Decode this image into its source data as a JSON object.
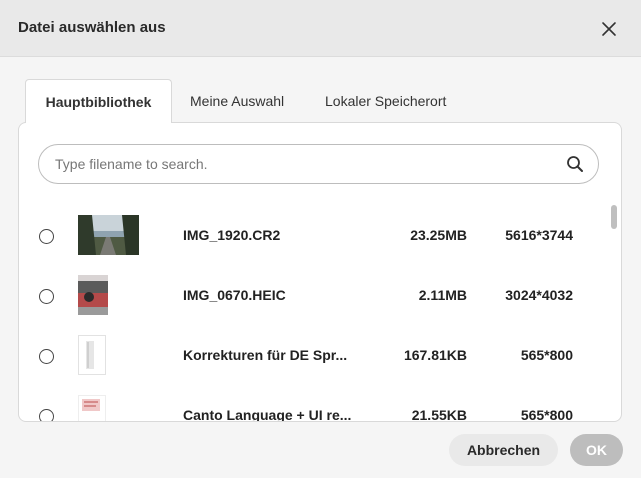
{
  "dialog": {
    "title": "Datei auswählen aus",
    "close_icon": "close-icon"
  },
  "tabs": [
    {
      "label": "Hauptbibliothek",
      "active": true
    },
    {
      "label": "Meine Auswahl",
      "active": false
    },
    {
      "label": "Lokaler Speicherort",
      "active": false
    }
  ],
  "search": {
    "placeholder": "Type filename to search.",
    "value": "",
    "icon": "search-icon"
  },
  "files": [
    {
      "name": "IMG_1920.CR2",
      "size": "23.25MB",
      "dimensions": "5616*3744",
      "thumb": "forest-photo"
    },
    {
      "name": "IMG_0670.HEIC",
      "size": "2.11MB",
      "dimensions": "3024*4032",
      "thumb": "car-photo"
    },
    {
      "name": "Korrekturen für DE Spr...",
      "size": "167.81KB",
      "dimensions": "565*800",
      "thumb": "document-page"
    },
    {
      "name": "Canto Language + UI re...",
      "size": "21.55KB",
      "dimensions": "565*800",
      "thumb": "document-page"
    }
  ],
  "footer": {
    "cancel_label": "Abbrechen",
    "ok_label": "OK"
  },
  "colors": {
    "header_bg": "#e9e9e9",
    "ok_disabled": "#bdbdbd",
    "cancel_bg": "#e9e9e9"
  }
}
